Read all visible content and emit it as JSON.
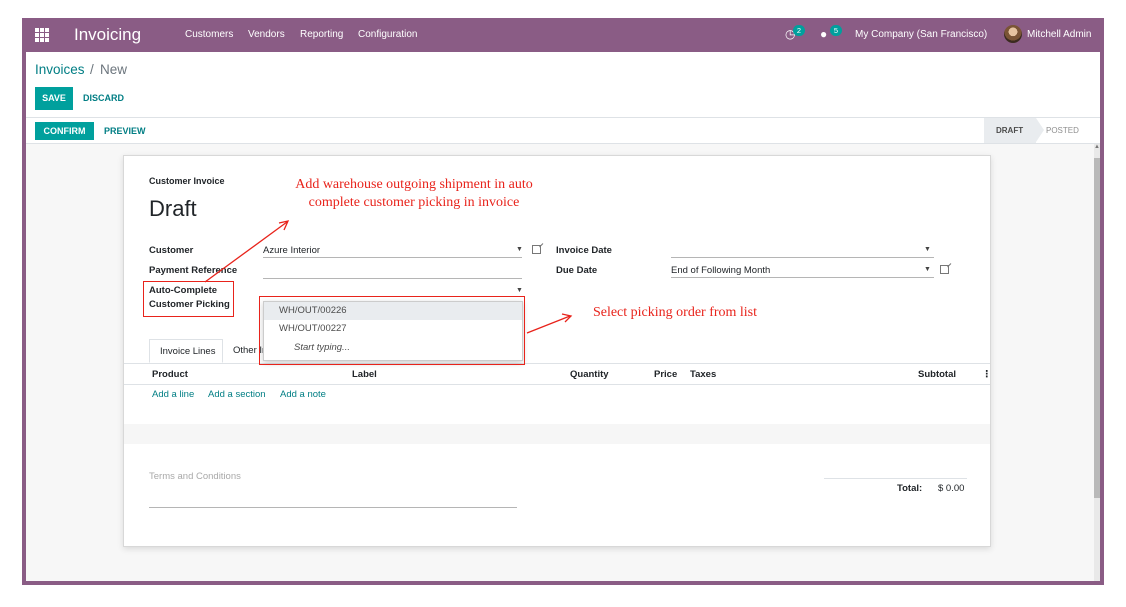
{
  "navbar": {
    "app_title": "Invoicing",
    "menu": [
      "Customers",
      "Vendors",
      "Reporting",
      "Configuration"
    ],
    "activity_count": "2",
    "messages_count": "5",
    "company": "My Company (San Francisco)",
    "user": "Mitchell Admin"
  },
  "breadcrumb": {
    "root": "Invoices",
    "separator": "/",
    "current": "New"
  },
  "buttons": {
    "save": "SAVE",
    "discard": "DISCARD",
    "confirm": "CONFIRM",
    "preview": "PREVIEW"
  },
  "statusbar": {
    "stages": [
      "DRAFT",
      "POSTED"
    ],
    "active_stage": "DRAFT"
  },
  "form": {
    "subtitle": "Customer Invoice",
    "title": "Draft",
    "customer_label": "Customer",
    "customer_value": "Azure Interior",
    "payment_ref_label": "Payment Reference",
    "payment_ref_value": "",
    "auto_complete_label_1": "Auto-Complete",
    "auto_complete_label_2": "Customer Picking",
    "invoice_date_label": "Invoice Date",
    "invoice_date_value": "",
    "due_date_label": "Due Date",
    "due_date_value": "End of Following Month"
  },
  "dropdown": {
    "options": [
      "WH/OUT/00226",
      "WH/OUT/00227"
    ],
    "search_placeholder": "Start typing..."
  },
  "tabs": [
    "Invoice Lines",
    "Other Info"
  ],
  "table": {
    "headers": [
      "Product",
      "Label",
      "Quantity",
      "Price",
      "Taxes",
      "Subtotal"
    ],
    "add_links": [
      "Add a line",
      "Add a section",
      "Add a note"
    ]
  },
  "terms_placeholder": "Terms and Conditions",
  "totals": {
    "label": "Total:",
    "value": "$ 0.00"
  },
  "annotations": {
    "top_1": "Add warehouse outgoing shipment in auto",
    "top_2": "complete customer picking in invoice",
    "right": "Select picking order from list"
  },
  "colors": {
    "navbar": "#8a5c85",
    "accent": "#00a09d",
    "link": "#017e84",
    "annotation": "#e8231b"
  }
}
